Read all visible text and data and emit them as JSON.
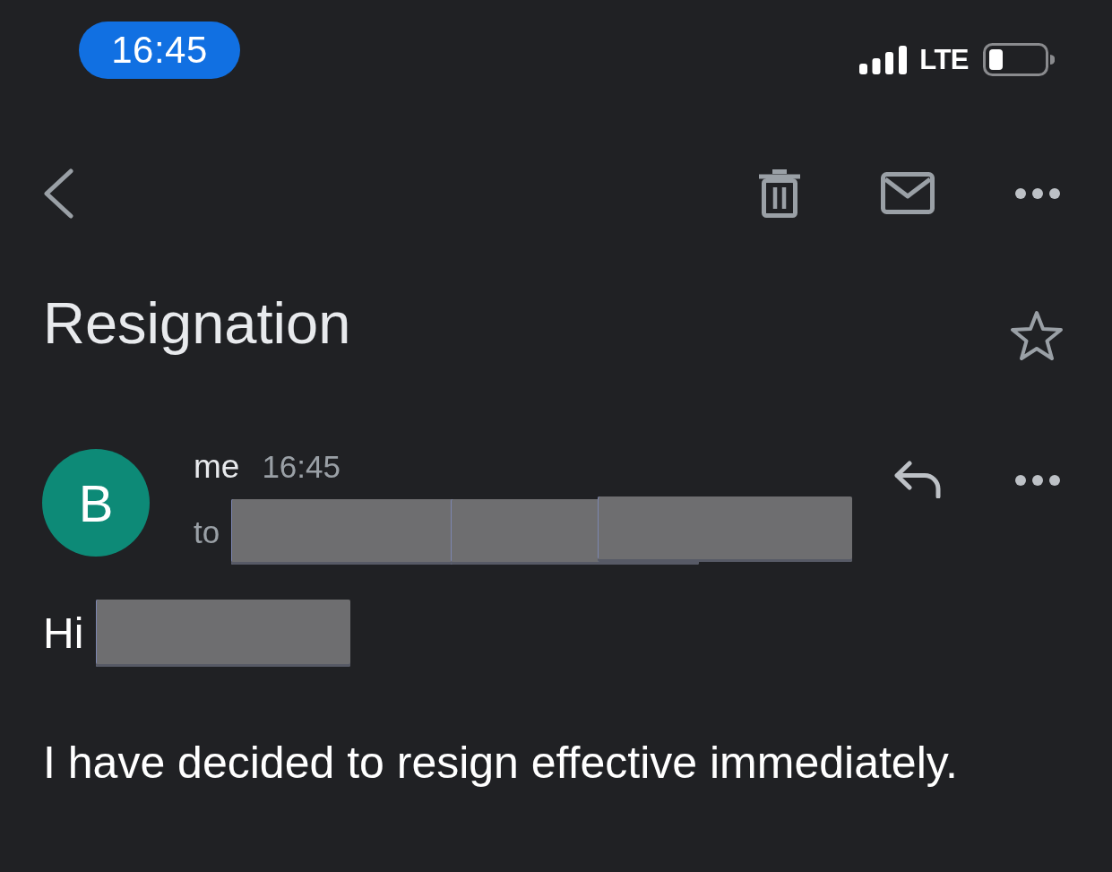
{
  "status_bar": {
    "time": "16:45",
    "network": "LTE"
  },
  "subject": {
    "title": "Resignation",
    "starred": false
  },
  "message": {
    "avatar_letter": "B",
    "sender": "me",
    "time": "16:45",
    "to_label": "to",
    "recipients": [
      {
        "redacted": true
      },
      {
        "redacted": true
      },
      {
        "redacted": true
      }
    ],
    "greeting": {
      "text": "Hi",
      "name_redacted": true
    },
    "paragraphs": [
      "I have decided to resign effective immediately."
    ]
  }
}
